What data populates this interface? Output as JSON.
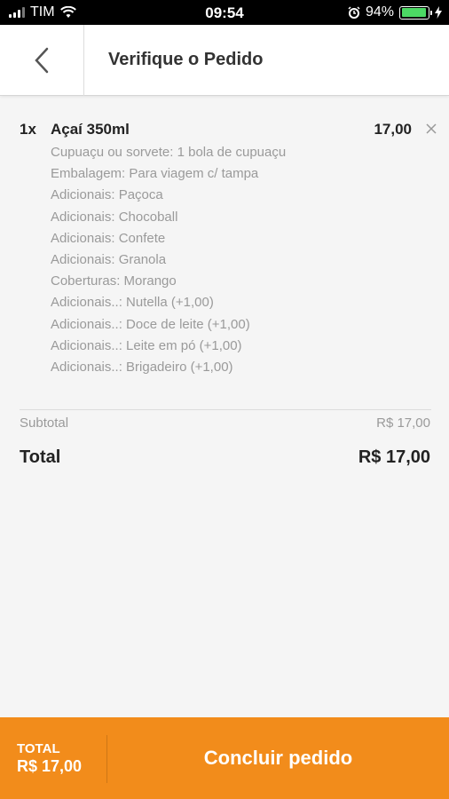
{
  "status_bar": {
    "carrier": "TIM",
    "time": "09:54",
    "battery": "94%",
    "battery_level": 0.94,
    "icons": [
      "signal-icon",
      "wifi-icon",
      "alarm-icon",
      "battery-icon",
      "charging-icon"
    ]
  },
  "header": {
    "back_icon": "chevron-left-icon",
    "title": "Verifique o Pedido"
  },
  "order": {
    "items": [
      {
        "qty": "1x",
        "name": "Açaí 350ml",
        "price": "17,00",
        "remove_icon": "close-icon",
        "options": [
          "Cupuaçu ou sorvete: 1 bola de cupuaçu",
          "Embalagem: Para viagem c/ tampa",
          "Adicionais: Paçoca",
          "Adicionais: Chocoball",
          "Adicionais: Confete",
          "Adicionais: Granola",
          "Coberturas: Morango",
          "Adicionais..: Nutella (+1,00)",
          "Adicionais..: Doce de leite (+1,00)",
          "Adicionais..: Leite em pó (+1,00)",
          "Adicionais..: Brigadeiro (+1,00)"
        ]
      }
    ],
    "subtotal_label": "Subtotal",
    "subtotal_value": "R$ 17,00",
    "total_label": "Total",
    "total_value": "R$ 17,00"
  },
  "footer": {
    "total_label": "TOTAL",
    "total_value": "R$ 17,00",
    "button_label": "Concluir pedido",
    "accent_color": "#f28c1b"
  }
}
